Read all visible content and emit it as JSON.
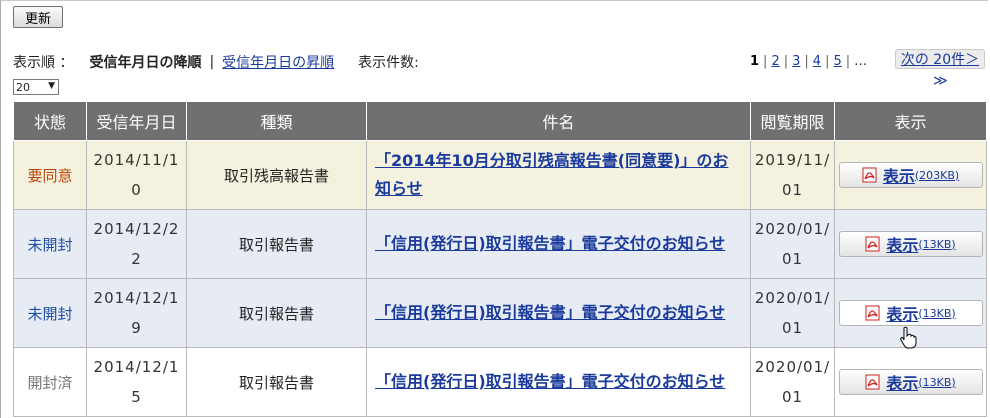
{
  "toolbar": {
    "refresh_label": "更新"
  },
  "sort": {
    "label": "表示順 ：",
    "current": "受信年月日の降順",
    "separator": "|",
    "alt": "受信年月日の昇順",
    "count_label": "表示件数:",
    "count_value": "20"
  },
  "pager": {
    "pages": [
      "1",
      "2",
      "3",
      "4",
      "5"
    ],
    "current": "1",
    "ellipsis": "…",
    "next_label": "次の 20件＞",
    "next_cont": "≫"
  },
  "table": {
    "headers": [
      "状態",
      "受信年月日",
      "種類",
      "件名",
      "閲覧期限",
      "表示"
    ],
    "rows": [
      {
        "status": "要同意",
        "received": "2014/11/10",
        "type": "取引残高報告書",
        "subject": "「2014年10月分取引残高報告書(同意要)」のお知らせ",
        "expiry": "2019/11/01",
        "show_label": "表示",
        "show_size": "(203KB)"
      },
      {
        "status": "未開封",
        "received": "2014/12/22",
        "type": "取引報告書",
        "subject": "「信用(発行日)取引報告書」電子交付のお知らせ",
        "expiry": "2020/01/01",
        "show_label": "表示",
        "show_size": "(13KB)"
      },
      {
        "status": "未開封",
        "received": "2014/12/19",
        "type": "取引報告書",
        "subject": "「信用(発行日)取引報告書」電子交付のお知らせ",
        "expiry": "2020/01/01",
        "show_label": "表示",
        "show_size": "(13KB)"
      },
      {
        "status": "開封済",
        "received": "2014/12/15",
        "type": "取引報告書",
        "subject": "「信用(発行日)取引報告書」電子交付のお知らせ",
        "expiry": "2020/01/01",
        "show_label": "表示",
        "show_size": "(13KB)"
      }
    ]
  },
  "colors": {
    "header_bg": "#707070",
    "link": "#1a3a9c",
    "status_agree": "#b9460a",
    "status_unread": "#1f4fa3",
    "status_read": "#777777",
    "row_agree_bg": "#f4f2df",
    "row_unread_bg": "#e7ecf4"
  },
  "icons": {
    "pdf": "pdf-icon",
    "cursor": "hand-pointer-icon"
  }
}
